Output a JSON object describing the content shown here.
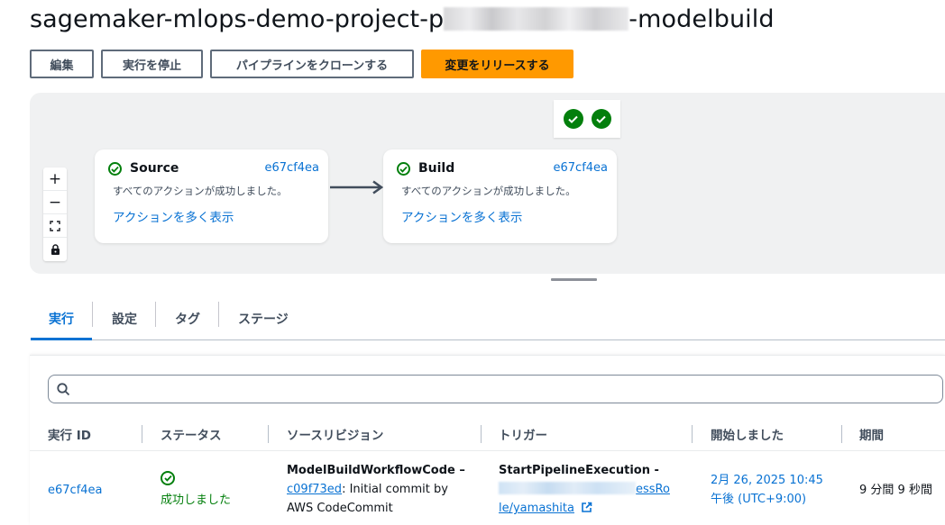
{
  "header": {
    "title_prefix": "sagemaker-mlops-demo-project-p",
    "title_suffix": "-modelbuild"
  },
  "actions": {
    "edit": "編集",
    "stop": "実行を停止",
    "clone": "パイプラインをクローンする",
    "release": "変更をリリースする"
  },
  "zoom": {
    "in": "+",
    "out": "−",
    "fit": "⛶",
    "lock": "🔒"
  },
  "stages": [
    {
      "name": "Source",
      "revision": "e67cf4ea",
      "status_message": "すべてのアクションが成功しました。",
      "more_link": "アクションを多く表示"
    },
    {
      "name": "Build",
      "revision": "e67cf4ea",
      "status_message": "すべてのアクションが成功しました。",
      "more_link": "アクションを多く表示"
    }
  ],
  "tabs": [
    "実行",
    "設定",
    "タグ",
    "ステージ"
  ],
  "table": {
    "columns": [
      "実行 ID",
      "ステータス",
      "ソースリビジョン",
      "トリガー",
      "開始しました",
      "期間"
    ],
    "rows": [
      {
        "execution_id": "e67cf4ea",
        "status": "成功しました",
        "source_title": "ModelBuildWorkflowCode –",
        "commit_id": "c09f73ed",
        "commit_msg_1": ": Initial commit by",
        "commit_msg_2": "AWS CodeCommit",
        "trigger_title": "StartPipelineExecution -",
        "trigger_role_tail": "essRo",
        "trigger_user": "le/yamashita",
        "started_1": "2月 26, 2025 10:45",
        "started_2": "午後 (UTC+9:00)",
        "duration": "9 分間 9 秒間"
      }
    ]
  },
  "colors": {
    "accent": "#0972d3",
    "primary_button": "#ff9900",
    "success": "#037f0c",
    "canvas": "#f0f1f2"
  }
}
